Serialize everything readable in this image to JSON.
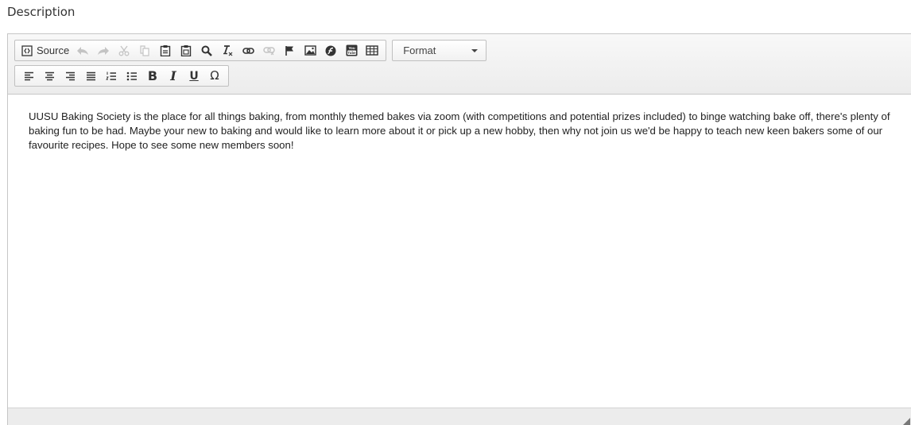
{
  "field": {
    "label": "Description"
  },
  "toolbar": {
    "source_label": "Source",
    "format_label": "Format"
  },
  "icons": {
    "source": "source-icon",
    "undo": "undo-icon",
    "redo": "redo-icon",
    "cut": "cut-icon",
    "copy": "copy-icon",
    "paste": "paste-icon",
    "paste_text": "paste-text-icon",
    "find": "search-icon",
    "remove_format": "remove-format-icon",
    "link": "link-icon",
    "unlink": "unlink-icon",
    "anchor": "flag-icon",
    "image": "image-icon",
    "flash": "flash-icon",
    "youtube": "youtube-icon",
    "table": "table-icon",
    "align_left": "align-left-icon",
    "align_center": "align-center-icon",
    "align_right": "align-right-icon",
    "justify": "justify-icon",
    "numbered_list": "numbered-list-icon",
    "bulleted_list": "bulleted-list-icon",
    "bold": "bold-icon",
    "italic": "italic-icon",
    "underline": "underline-icon",
    "special_char": "omega-icon"
  },
  "glyphs": {
    "bold": "B",
    "italic": "I",
    "underline": "U",
    "special_char": "Ω",
    "youtube_top": "You",
    "youtube_bottom": "Tube"
  },
  "editor": {
    "content": "UUSU Baking Society is the place for all things baking, from monthly themed bakes via zoom (with competitions and potential prizes included) to binge watching bake off, there's plenty of baking fun to be had. Maybe your new to baking and would like to learn more about it or pick up a new hobby, then why not join us we'd be happy to teach new keen bakers some of our favourite recipes. Hope to see some new members soon!"
  },
  "colors": {
    "toolbar_bg": "#f1f1f1",
    "border": "#c6c6c6",
    "disabled_icon": "#bdbdbd",
    "text": "#222222"
  }
}
